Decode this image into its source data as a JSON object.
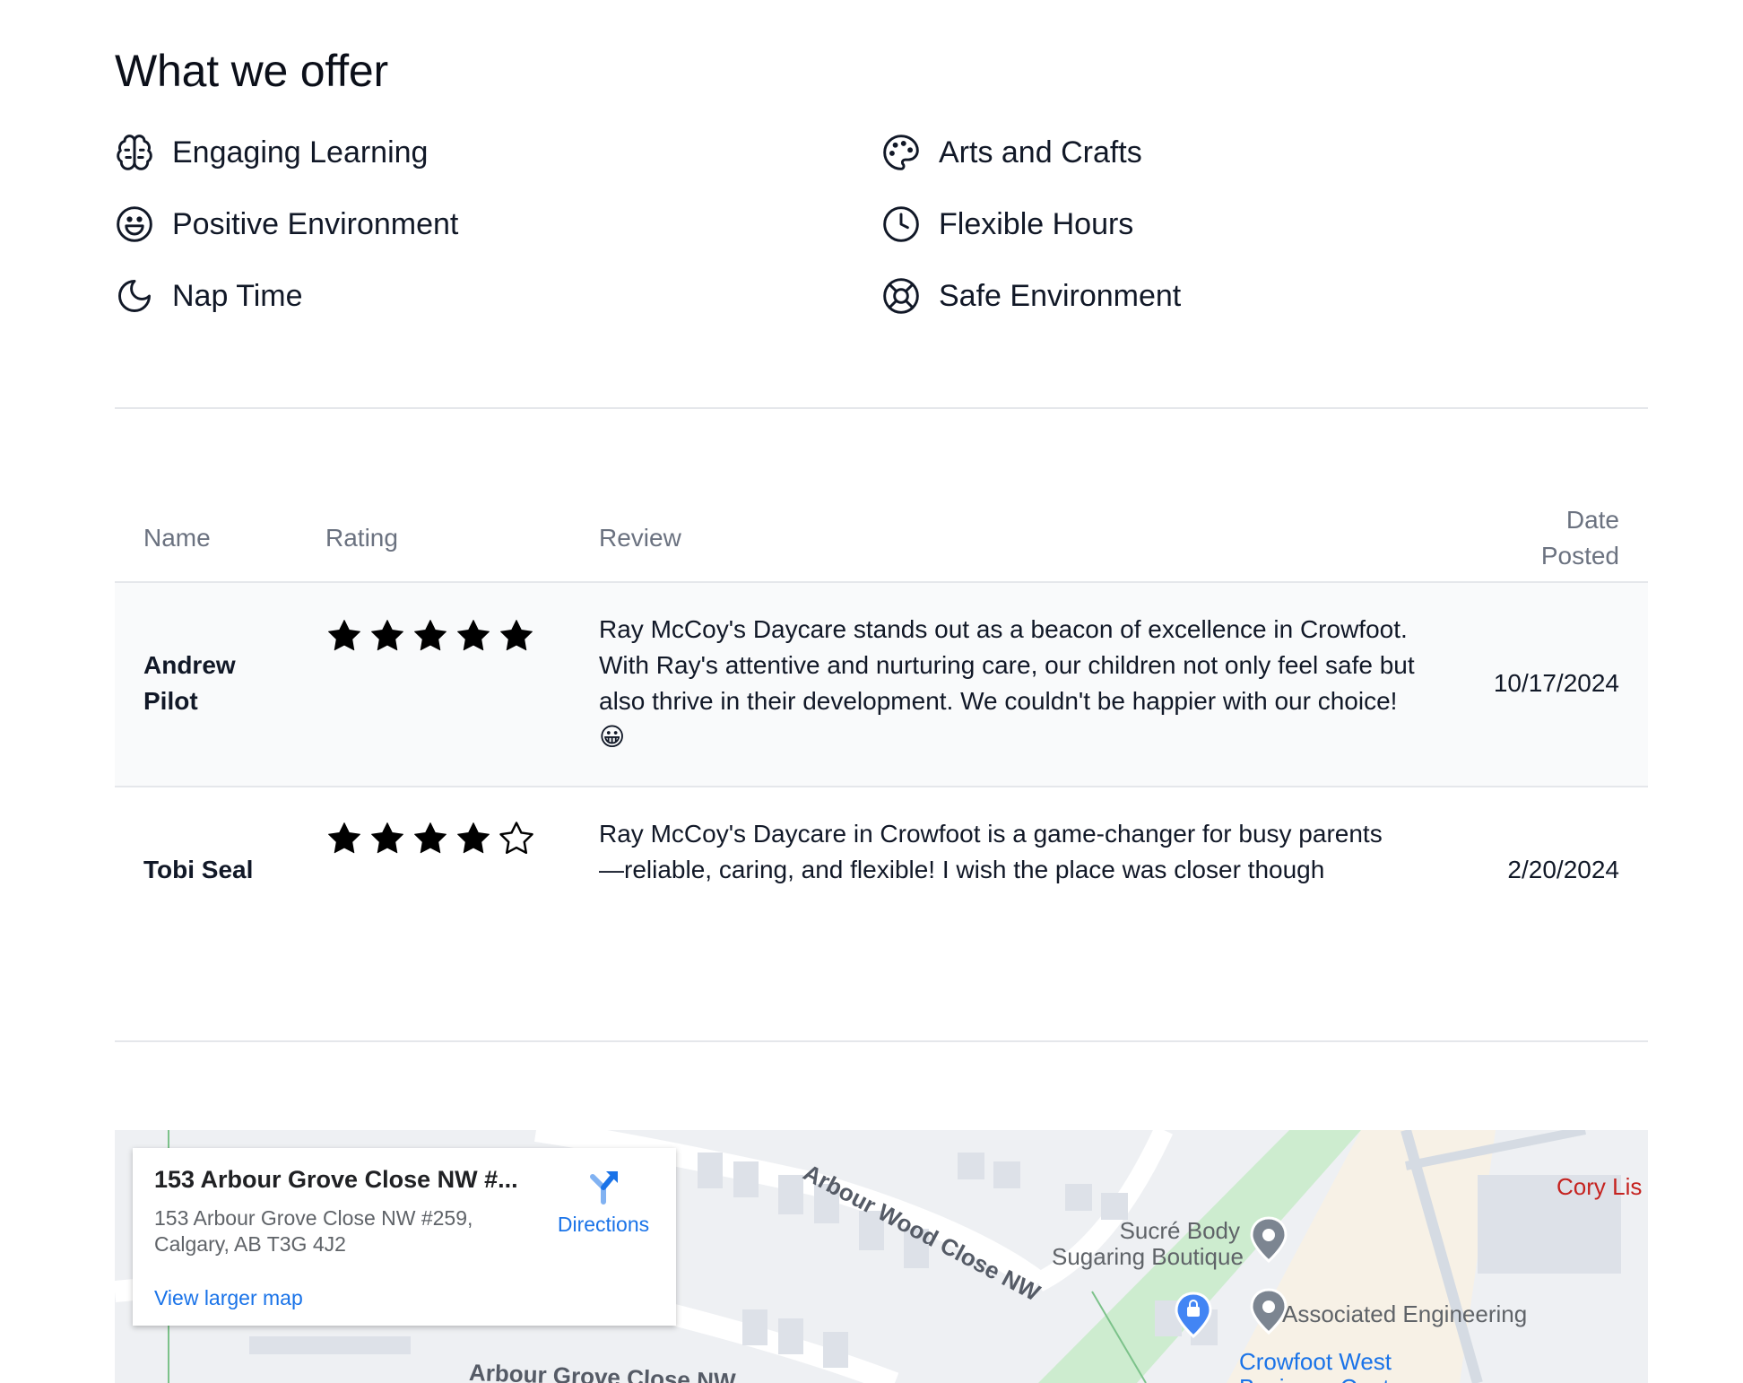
{
  "offer": {
    "title": "What we offer",
    "features": [
      {
        "label": "Engaging Learning",
        "icon": "brain-icon"
      },
      {
        "label": "Arts and Crafts",
        "icon": "palette-icon"
      },
      {
        "label": "Positive Environment",
        "icon": "smile-icon"
      },
      {
        "label": "Flexible Hours",
        "icon": "clock-icon"
      },
      {
        "label": "Nap Time",
        "icon": "moon-icon"
      },
      {
        "label": "Safe Environment",
        "icon": "lifebuoy-icon"
      }
    ]
  },
  "reviews": {
    "headers": {
      "name": "Name",
      "rating": "Rating",
      "review": "Review",
      "date_line1": "Date",
      "date_line2": "Posted"
    },
    "rows": [
      {
        "name_line1": "Andrew",
        "name_line2": "Pilot",
        "rating": 5,
        "max_rating": 5,
        "review": "Ray McCoy's Daycare stands out as a beacon of excellence in Crowfoot. With Ray's attentive and nurturing care, our children not only feel safe but also thrive in their development. We couldn't be happier with our choice! 😀",
        "date": "10/17/2024"
      },
      {
        "name_line1": "Tobi Seal",
        "name_line2": "",
        "rating": 4,
        "max_rating": 5,
        "review": "Ray McCoy's Daycare in Crowfoot is a game-changer for busy parents—reliable, caring, and flexible! I wish the place was closer though",
        "date": "2/20/2024"
      }
    ]
  },
  "map": {
    "card": {
      "title": "153 Arbour Grove Close NW #...",
      "address_line1": "153 Arbour Grove Close NW #259,",
      "address_line2": "Calgary, AB T3G 4J2",
      "view_larger": "View larger map",
      "directions": "Directions"
    },
    "labels": {
      "street1": "Arbour Wood Close NW",
      "street2": "Arbour Grove Close NW",
      "place1_line1": "Sucré Body",
      "place1_line2": "Sugaring Boutique",
      "place2": "Associated Engineering",
      "place3_line1": "Crowfoot West",
      "place3_line2": "Business Centre",
      "place4": "Cory Lis"
    },
    "colors": {
      "link": "#1a73e8",
      "park": "#cdeccf",
      "road": "#ffffff"
    }
  }
}
